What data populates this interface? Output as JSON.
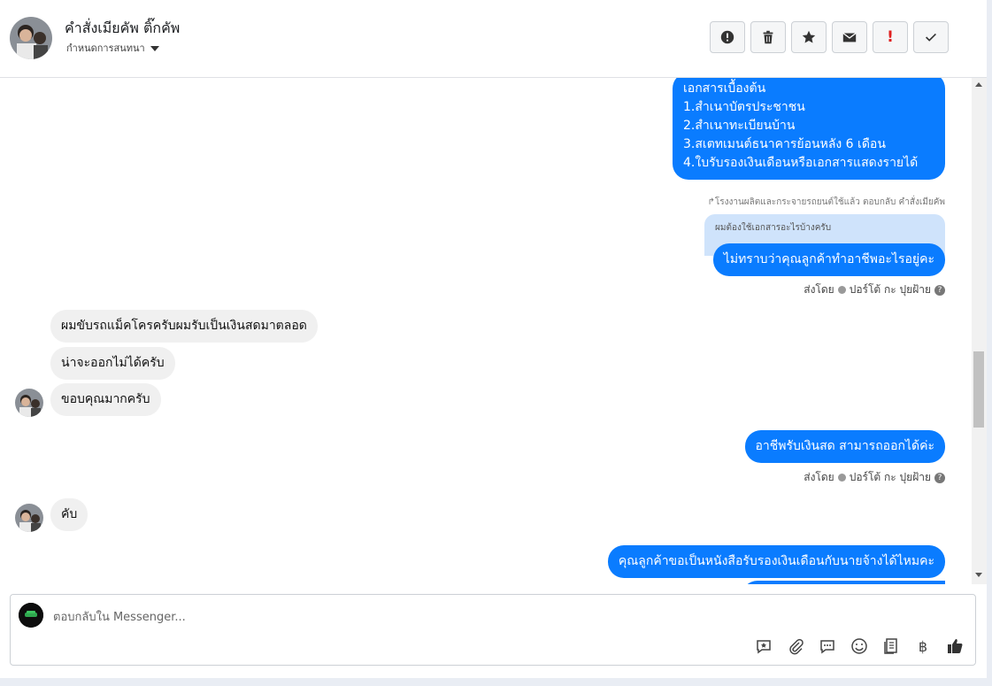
{
  "header": {
    "contact_name": "คำสั่งเมียคัพ ติ๊กคัพ",
    "assign_label": "กำหนดการสนทนา"
  },
  "actions": [
    {
      "icon": "alert-circle-icon"
    },
    {
      "icon": "trash-icon"
    },
    {
      "icon": "star-icon"
    },
    {
      "icon": "envelope-icon"
    },
    {
      "icon": "exclamation-red-icon",
      "label": "!"
    },
    {
      "icon": "check-icon"
    }
  ],
  "messages": {
    "docs_list": [
      "เอกสารเบื้องต้น",
      "1.สำเนาบัตรประชาชน",
      "2.สำเนาทะเบียนบ้าน",
      "3.สเตทเมนต์ธนาคารย้อนหลัง 6 เดือน",
      "4.ใบรับรองเงินเดือนหรือเอกสารแสดงรายได้"
    ],
    "reply_note": "↱โรงงานผลิตและกระจายรถยนต์ใช้แล้ว ตอบกลับ คำสั่งเมียคัพ",
    "quoted": "ผมต้องใช้เอกสารอะไรบ้างครับ",
    "out_1": "ไม่ทราบว่าคุณลูกค้าทำอาชีพอะไรอยู่คะ",
    "sent_by_1": "ส่งโดย",
    "sender_1": "ปอร์โต้ กะ ปุยฝ้าย",
    "in_1": "ผมขับรถแม็คโครครับผมรับเป็นเงินสดมาตลอด",
    "in_2": "น่าจะออกไม่ได้ครับ",
    "in_3": "ขอบคุณมากครับ",
    "out_2": "อาชีพรับเงินสด สามารถออกได้ค่ะ",
    "sent_by_2": "ส่งโดย",
    "sender_2": "ปอร์โต้ กะ ปุยฝ้าย",
    "in_4": "คับ",
    "out_3": "คุณลูกค้าขอเป็นหนังสือรับรองเงินเดือนกับนายจ้างได้ไหมคะ"
  },
  "composer": {
    "placeholder": "ตอบกลับใน Messenger...",
    "currency_symbol": "฿"
  },
  "colors": {
    "outgoing_bubble": "#0a7cff",
    "incoming_bubble": "#f0f0f0",
    "quote_bg": "#cfe3fb"
  }
}
